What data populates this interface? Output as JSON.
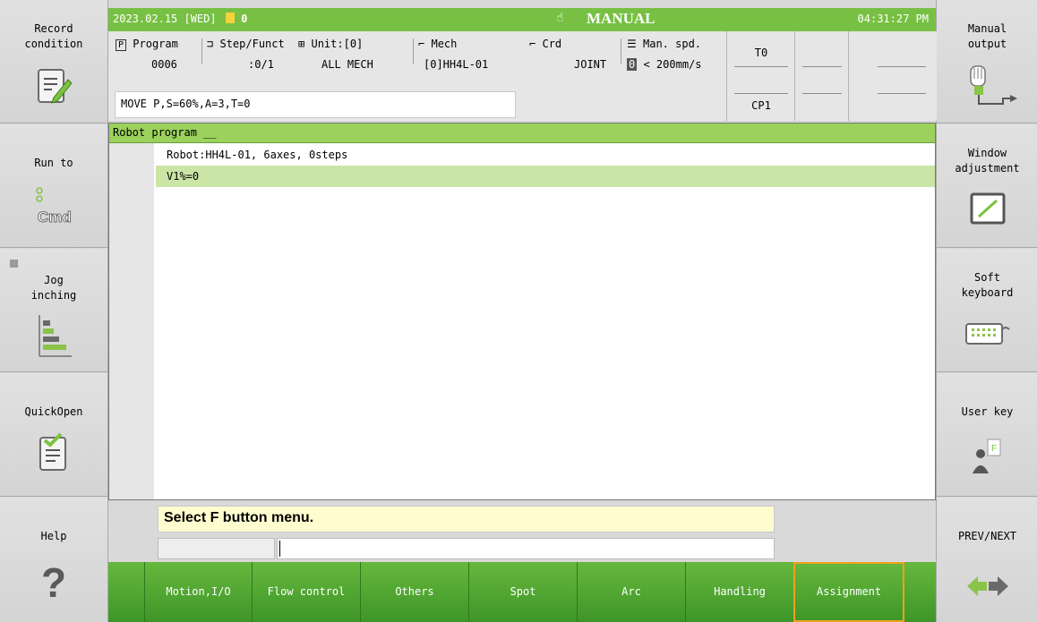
{
  "status": {
    "datetime": "2023.02.15 [WED]",
    "counter": "0",
    "mode": "MANUAL",
    "time": "04:31:27 PM"
  },
  "info": {
    "program": {
      "label": "Program",
      "value": "0006"
    },
    "step": {
      "label": "Step/Funct",
      "value": ":0/1"
    },
    "unit": {
      "label": "Unit:[0]",
      "value": "ALL MECH"
    },
    "mech": {
      "label": "Mech",
      "value": "[0]HH4L-01"
    },
    "crd": {
      "label": "Crd",
      "value": "JOINT"
    },
    "speed": {
      "label": "Man. spd.",
      "level": "0",
      "value": "< 200mm/s"
    },
    "tool": "T0",
    "cp": "CP1",
    "command": "MOVE P,S=60%,A=3,T=0"
  },
  "program_area": {
    "header": "Robot program __",
    "lines": [
      "Robot:HH4L-01, 6axes, 0steps",
      "V1%=0"
    ]
  },
  "message": "Select F button menu.",
  "left_buttons": [
    {
      "label": "Record\ncondition",
      "icon": "record-condition-icon"
    },
    {
      "label": "Run to",
      "icon": "cmd-icon"
    },
    {
      "label": "Jog\ninching",
      "icon": "jog-inching-icon"
    },
    {
      "label": "QuickOpen",
      "icon": "quickopen-icon"
    },
    {
      "label": "Help",
      "icon": "help-icon"
    }
  ],
  "right_buttons": [
    {
      "label": "Manual\noutput",
      "icon": "manual-output-icon"
    },
    {
      "label": "Window\nadjustment",
      "icon": "window-adjust-icon"
    },
    {
      "label": "Soft\nkeyboard",
      "icon": "keyboard-icon"
    },
    {
      "label": "User key",
      "icon": "user-key-icon"
    },
    {
      "label": "PREV/NEXT",
      "icon": "prev-next-icon"
    }
  ],
  "f_buttons": [
    "Motion,I/O",
    "Flow control",
    "Others",
    "Spot",
    "Arc",
    "Handling",
    "Assignment"
  ],
  "colors": {
    "green": "#77c043",
    "header_green": "#9bd15c",
    "selected_line": "#cbe5a6",
    "message_bg": "#fffdd0",
    "fkey_selected": "#f0a020"
  }
}
